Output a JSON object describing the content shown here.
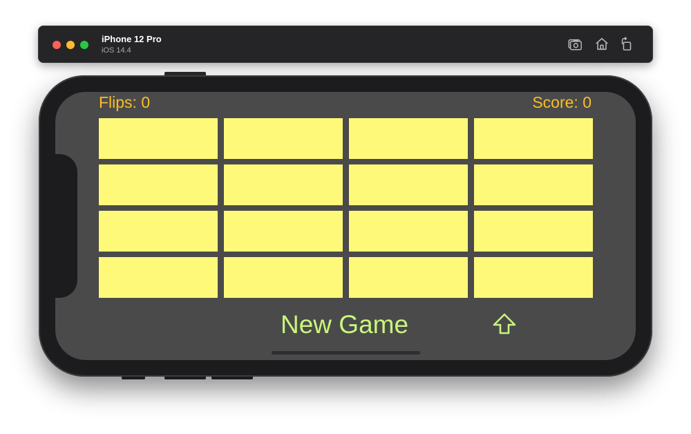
{
  "simulator": {
    "device_name": "iPhone 12 Pro",
    "os_version": "iOS 14.4",
    "toolbar_icons": [
      "screenshot-icon",
      "home-icon",
      "rotate-icon"
    ]
  },
  "game": {
    "flips_label": "Flips: 0",
    "score_label": "Score: 0",
    "cards": [
      {
        "state": "face-down"
      },
      {
        "state": "face-down"
      },
      {
        "state": "face-down"
      },
      {
        "state": "face-down"
      },
      {
        "state": "face-down"
      },
      {
        "state": "face-down"
      },
      {
        "state": "face-down"
      },
      {
        "state": "face-down"
      },
      {
        "state": "face-down"
      },
      {
        "state": "face-down"
      },
      {
        "state": "face-down"
      },
      {
        "state": "face-down"
      },
      {
        "state": "face-down"
      },
      {
        "state": "face-down"
      },
      {
        "state": "face-down"
      },
      {
        "state": "face-down"
      }
    ],
    "new_game_label": "New Game",
    "share_icon": "up-arrow-icon"
  },
  "colors": {
    "card_back": "#fff97a",
    "label_color": "#fbbe25",
    "button_color": "#c9f57d",
    "screen_background": "#4a4a4a"
  }
}
